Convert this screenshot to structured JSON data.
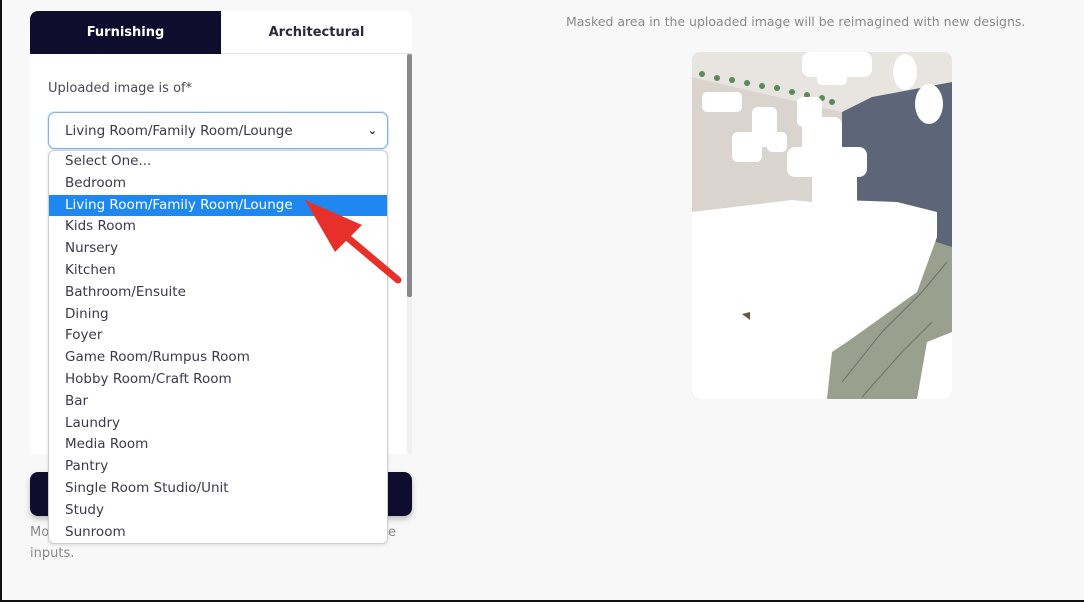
{
  "tabs": [
    {
      "label": "Furnishing",
      "active": true
    },
    {
      "label": "Architectural",
      "active": false
    }
  ],
  "form": {
    "room_type_label": "Uploaded image is of*",
    "room_type_value": "Living Room/Family Room/Lounge",
    "room_type_options": [
      "Select One...",
      "Bedroom",
      "Living Room/Family Room/Lounge",
      "Kids Room",
      "Nursery",
      "Kitchen",
      "Bathroom/Ensuite",
      "Dining",
      "Foyer",
      "Game Room/Rumpus Room",
      "Hobby Room/Craft Room",
      "Bar",
      "Laundry",
      "Media Room",
      "Pantry",
      "Single Room Studio/Unit",
      "Study",
      "Sunroom"
    ],
    "selected_index": 2
  },
  "footer": {
    "fragment_left": "Mo",
    "fragment_right": "e",
    "line2": "inputs."
  },
  "preview": {
    "note": "Masked area in the uploaded image will be reimagined with new designs."
  },
  "colors": {
    "tab_active_bg": "#0f0d2e",
    "selected_option_bg": "#1e88f0",
    "annotation_arrow": "#e8302a"
  },
  "annotation": {
    "type": "arrow",
    "target": "selected-option"
  }
}
